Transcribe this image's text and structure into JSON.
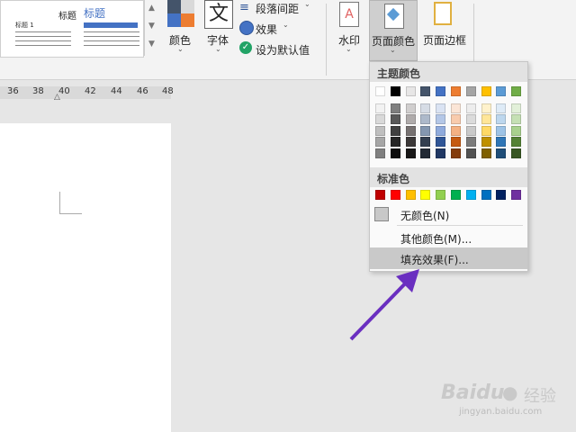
{
  "ribbon": {
    "theme_preview": {
      "title_left": "标题",
      "title_right": "标题",
      "heading1": "标题 1"
    },
    "colors_label": "颜色",
    "font_label": "字体",
    "font_glyph": "文",
    "paragraph_spacing_label": "段落间距",
    "effects_label": "效果",
    "set_default_label": "设为默认值",
    "watermark_label": "水印",
    "page_color_label": "页面颜色",
    "page_border_label": "页面边框"
  },
  "ruler": {
    "ticks": [
      "36",
      "38",
      "40",
      "42",
      "44",
      "46",
      "48"
    ]
  },
  "page_color_menu": {
    "theme_colors_header": "主题颜色",
    "standard_colors_header": "标准色",
    "no_color_label": "无颜色(N)",
    "more_colors_label": "其他颜色(M)...",
    "fill_effects_label": "填充效果(F)...",
    "theme_colors": [
      [
        "#ffffff",
        "#f2f2f2",
        "#d9d9d9",
        "#bfbfbf",
        "#a6a6a6",
        "#808080"
      ],
      [
        "#000000",
        "#7f7f7f",
        "#595959",
        "#404040",
        "#262626",
        "#0d0d0d"
      ],
      [
        "#e7e6e6",
        "#d0cece",
        "#afabab",
        "#767171",
        "#3b3838",
        "#181717"
      ],
      [
        "#44546a",
        "#d6dce5",
        "#adb9ca",
        "#8497b0",
        "#333f50",
        "#222a35"
      ],
      [
        "#4472c4",
        "#dae3f3",
        "#b4c7e7",
        "#8faadc",
        "#2f5597",
        "#203864"
      ],
      [
        "#ed7d31",
        "#fbe5d6",
        "#f8cbad",
        "#f4b183",
        "#c55a11",
        "#843c0c"
      ],
      [
        "#a5a5a5",
        "#ededed",
        "#dbdbdb",
        "#c9c9c9",
        "#7b7b7b",
        "#525252"
      ],
      [
        "#ffc000",
        "#fff2cc",
        "#ffe699",
        "#ffd966",
        "#bf9000",
        "#7f6000"
      ],
      [
        "#5b9bd5",
        "#deebf7",
        "#bdd7ee",
        "#9dc3e6",
        "#2e75b6",
        "#1f4e79"
      ],
      [
        "#70ad47",
        "#e2f0d9",
        "#c5e0b4",
        "#a9d18e",
        "#548235",
        "#385723"
      ]
    ],
    "standard_colors": [
      "#c00000",
      "#ff0000",
      "#ffc000",
      "#ffff00",
      "#92d050",
      "#00b050",
      "#00b0f0",
      "#0070c0",
      "#002060",
      "#7030a0"
    ]
  },
  "watermark_site": {
    "brand": "Baidu",
    "brand_cn": "经验",
    "url": "jingyan.baidu.com"
  },
  "colors": {
    "accent_arrow": "#6a2fc0",
    "highlight": "#c9c9c9",
    "page_color_selected_bg": "#cfcfcf"
  }
}
